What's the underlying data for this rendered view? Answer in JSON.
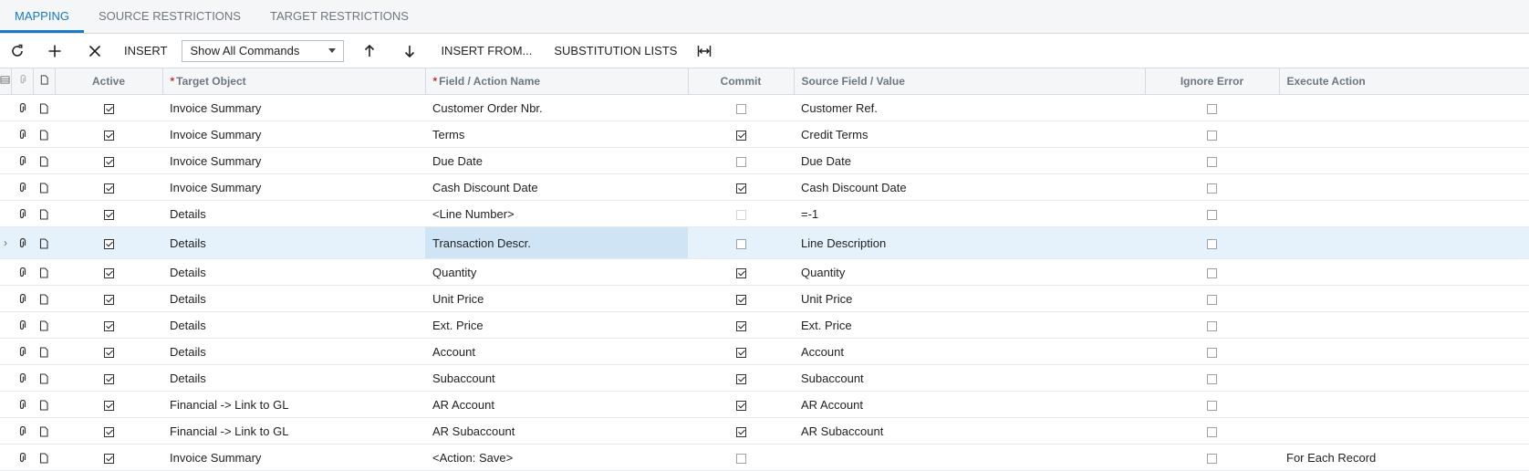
{
  "tabs": [
    "MAPPING",
    "SOURCE RESTRICTIONS",
    "TARGET RESTRICTIONS"
  ],
  "toolbar": {
    "insert": "INSERT",
    "command_select": "Show All Commands",
    "insert_from": "INSERT FROM...",
    "substitution_lists": "SUBSTITUTION LISTS"
  },
  "columns": {
    "active": "Active",
    "target_object": "Target Object",
    "field_action": "Field / Action Name",
    "commit": "Commit",
    "source_field": "Source Field / Value",
    "ignore_error": "Ignore Error",
    "execute_action": "Execute Action"
  },
  "rows": [
    {
      "active": true,
      "target": "Invoice Summary",
      "field": "Customer Order Nbr.",
      "commit": false,
      "source": "Customer Ref.",
      "ignore": false,
      "execute": ""
    },
    {
      "active": true,
      "target": "Invoice Summary",
      "field": "Terms",
      "commit": true,
      "source": "Credit Terms",
      "ignore": false,
      "execute": ""
    },
    {
      "active": true,
      "target": "Invoice Summary",
      "field": "Due Date",
      "commit": false,
      "source": "Due Date",
      "ignore": false,
      "execute": ""
    },
    {
      "active": true,
      "target": "Invoice Summary",
      "field": "Cash Discount Date",
      "commit": true,
      "source": "Cash Discount Date",
      "ignore": false,
      "execute": ""
    },
    {
      "active": true,
      "target": "Details",
      "field": "<Line Number>",
      "commit": false,
      "commit_disabled": true,
      "source": "=-1",
      "ignore": false,
      "execute": ""
    },
    {
      "active": true,
      "target": "Details",
      "field": "Transaction Descr.",
      "commit": false,
      "source": "Line Description",
      "ignore": false,
      "execute": "",
      "selected": true
    },
    {
      "active": true,
      "target": "Details",
      "field": "Quantity",
      "commit": true,
      "source": "Quantity",
      "ignore": false,
      "execute": ""
    },
    {
      "active": true,
      "target": "Details",
      "field": "Unit Price",
      "commit": true,
      "source": "Unit Price",
      "ignore": false,
      "execute": ""
    },
    {
      "active": true,
      "target": "Details",
      "field": "Ext. Price",
      "commit": true,
      "source": "Ext. Price",
      "ignore": false,
      "execute": ""
    },
    {
      "active": true,
      "target": "Details",
      "field": "Account",
      "commit": true,
      "source": "Account",
      "ignore": false,
      "execute": ""
    },
    {
      "active": true,
      "target": "Details",
      "field": "Subaccount",
      "commit": true,
      "source": "Subaccount",
      "ignore": false,
      "execute": ""
    },
    {
      "active": true,
      "target": "Financial -> Link to GL",
      "field": "AR Account",
      "commit": true,
      "source": "AR Account",
      "ignore": false,
      "execute": ""
    },
    {
      "active": true,
      "target": "Financial -> Link to GL",
      "field": "AR Subaccount",
      "commit": true,
      "source": "AR Subaccount",
      "ignore": false,
      "execute": ""
    },
    {
      "active": true,
      "target": "Invoice Summary",
      "field": "<Action: Save>",
      "commit": false,
      "source": "",
      "ignore": false,
      "execute": "For Each Record"
    }
  ]
}
